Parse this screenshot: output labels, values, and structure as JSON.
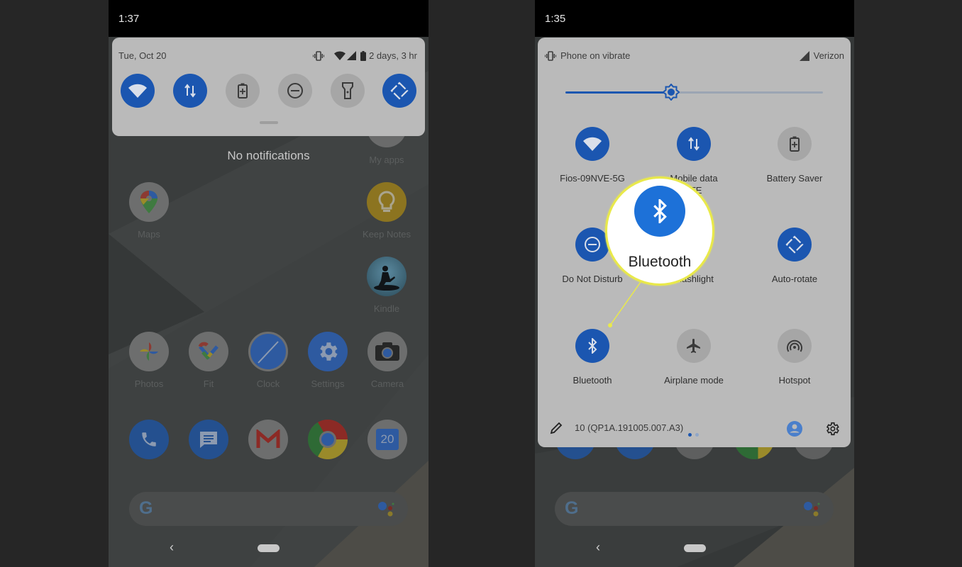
{
  "left_phone": {
    "status_time": "1:37",
    "quick_settings": {
      "date": "Tue, Oct 20",
      "battery_text": "2 days, 3 hr",
      "status_icons": [
        "vibrate-icon",
        "wifi-icon",
        "signal-icon",
        "battery-icon"
      ],
      "tiles": [
        {
          "name": "wifi",
          "icon": "wifi-icon",
          "state": "on"
        },
        {
          "name": "mobile-data",
          "icon": "data-arrows-icon",
          "state": "on"
        },
        {
          "name": "battery-saver",
          "icon": "battery-plus-icon",
          "state": "off"
        },
        {
          "name": "do-not-disturb",
          "icon": "minus-circle-icon",
          "state": "off"
        },
        {
          "name": "flashlight",
          "icon": "flashlight-icon",
          "state": "off"
        },
        {
          "name": "auto-rotate",
          "icon": "rotate-icon",
          "state": "on"
        }
      ]
    },
    "no_notifications": "No notifications",
    "apps": [
      {
        "label": "My apps"
      },
      {
        "label": "Maps"
      },
      {
        "label": "Keep Notes"
      },
      {
        "label": "Kindle"
      },
      {
        "label": "Photos"
      },
      {
        "label": "Fit"
      },
      {
        "label": "Clock"
      },
      {
        "label": "Settings"
      },
      {
        "label": "Camera"
      }
    ],
    "dock": [
      "Phone",
      "Messages",
      "Gmail",
      "Chrome",
      "Calendar"
    ],
    "calendar_day": "20",
    "nav": {
      "back_glyph": "‹"
    }
  },
  "right_phone": {
    "status_time": "1:35",
    "quick_settings": {
      "ringer_status": "Phone on vibrate",
      "carrier": "Verizon",
      "brightness_fraction": 0.41,
      "tiles": [
        {
          "label": "Fios-09NVE-5G",
          "icon": "wifi-icon",
          "state": "on"
        },
        {
          "label": "Mobile data",
          "sublabel": "LTE",
          "icon": "data-arrows-icon",
          "state": "on"
        },
        {
          "label": "Battery Saver",
          "icon": "battery-plus-icon",
          "state": "off"
        },
        {
          "label": "Do Not Disturb",
          "icon": "minus-circle-icon",
          "state": "on"
        },
        {
          "label": "Flashlight",
          "icon": "flashlight-icon",
          "state": "off"
        },
        {
          "label": "Auto-rotate",
          "icon": "rotate-icon",
          "state": "on"
        },
        {
          "label": "Bluetooth",
          "icon": "bluetooth-icon",
          "state": "on"
        },
        {
          "label": "Airplane mode",
          "icon": "airplane-icon",
          "state": "off"
        },
        {
          "label": "Hotspot",
          "icon": "hotspot-icon",
          "state": "off"
        }
      ],
      "build_number": "10 (QP1A.191005.007.A3)",
      "page_count": 2,
      "current_page": 1
    },
    "callout": {
      "label": "Bluetooth",
      "color": "#e9e94a"
    }
  },
  "colors": {
    "tile_active": "#1b56b0",
    "tile_inactive": "#a6a6a6",
    "panel": "#bababa",
    "callout_bt": "#1d71d8"
  }
}
